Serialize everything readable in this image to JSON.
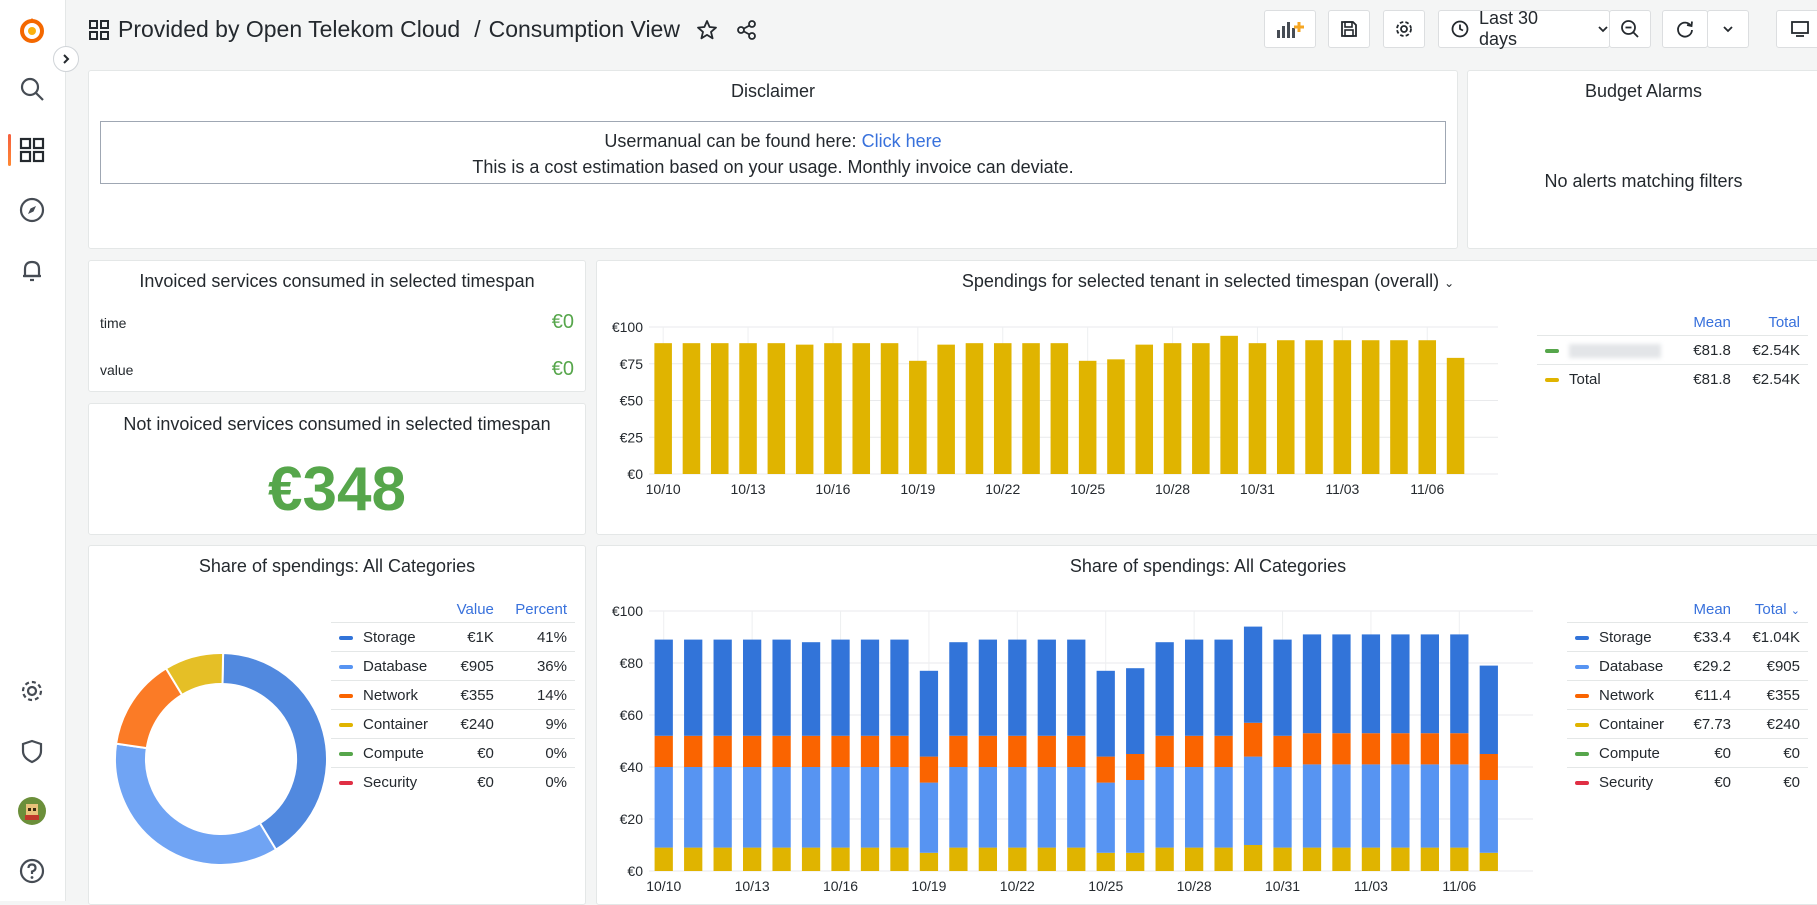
{
  "breadcrumb": {
    "folder": "Provided by Open Telekom Cloud",
    "separator": "/",
    "dashboard": "Consumption View"
  },
  "toolbar": {
    "time_range": "Last 30 days"
  },
  "disclaimer": {
    "title": "Disclaimer",
    "line1_prefix": "Usermanual can be found here:",
    "link_text": "Click here",
    "line2": "This is a cost estimation based on your usage. Monthly invoice can deviate."
  },
  "budget": {
    "title": "Budget Alarms",
    "empty_text": "No alerts matching filters"
  },
  "invoiced": {
    "title": "Invoiced services consumed in selected timespan",
    "rows": [
      {
        "label": "time",
        "value": "€0"
      },
      {
        "label": "value",
        "value": "€0"
      }
    ]
  },
  "not_invoiced": {
    "title": "Not invoiced services consumed in selected timespan",
    "value": "€348"
  },
  "spend_overall": {
    "title": "Spendings for selected tenant in selected timespan (overall)",
    "legend_headers": [
      "Mean",
      "Total"
    ],
    "legend": [
      {
        "name": "",
        "mean": "€81.8",
        "total": "€2.54K",
        "color": "#56a64b",
        "blurred": true
      },
      {
        "name": "Total",
        "mean": "€81.8",
        "total": "€2.54K",
        "color": "#e0b400"
      }
    ]
  },
  "share_donut": {
    "title": "Share of spendings: All Categories",
    "legend_headers": [
      "Value",
      "Percent"
    ],
    "legend": [
      {
        "name": "Storage",
        "value": "€1K",
        "percent": "41%",
        "color": "#3274d9"
      },
      {
        "name": "Database",
        "value": "€905",
        "percent": "36%",
        "color": "#5794f2"
      },
      {
        "name": "Network",
        "value": "€355",
        "percent": "14%",
        "color": "#fa6400"
      },
      {
        "name": "Container",
        "value": "€240",
        "percent": "9%",
        "color": "#e0b400"
      },
      {
        "name": "Compute",
        "value": "€0",
        "percent": "0%",
        "color": "#56a64b"
      },
      {
        "name": "Security",
        "value": "€0",
        "percent": "0%",
        "color": "#e02f44"
      }
    ]
  },
  "share_bars": {
    "title": "Share of spendings: All Categories",
    "legend_headers": [
      "Mean",
      "Total"
    ],
    "legend": [
      {
        "name": "Storage",
        "mean": "€33.4",
        "total": "€1.04K",
        "color": "#3274d9"
      },
      {
        "name": "Database",
        "mean": "€29.2",
        "total": "€905",
        "color": "#5794f2"
      },
      {
        "name": "Network",
        "mean": "€11.4",
        "total": "€355",
        "color": "#fa6400"
      },
      {
        "name": "Container",
        "mean": "€7.73",
        "total": "€240",
        "color": "#e0b400"
      },
      {
        "name": "Compute",
        "mean": "€0",
        "total": "€0",
        "color": "#56a64b"
      },
      {
        "name": "Security",
        "mean": "€0",
        "total": "€0",
        "color": "#e02f44"
      }
    ]
  },
  "chart_data": [
    {
      "type": "bar",
      "x_ticks": [
        "10/10",
        "10/13",
        "10/16",
        "10/19",
        "10/22",
        "10/25",
        "10/28",
        "10/31",
        "11/03",
        "11/06"
      ],
      "y_ticks": [
        "€0",
        "€25",
        "€50",
        "€75",
        "€100"
      ],
      "ylim": [
        0,
        100
      ],
      "series": [
        {
          "name": "Total",
          "values": [
            89,
            89,
            89,
            89,
            89,
            88,
            89,
            89,
            89,
            77,
            88,
            89,
            89,
            89,
            89,
            77,
            78,
            88,
            89,
            89,
            94,
            89,
            91,
            91,
            91,
            91,
            91,
            91,
            79,
            0
          ]
        }
      ]
    },
    {
      "type": "bar",
      "stacked": true,
      "x_ticks": [
        "10/10",
        "10/13",
        "10/16",
        "10/19",
        "10/22",
        "10/25",
        "10/28",
        "10/31",
        "11/03",
        "11/06"
      ],
      "y_ticks": [
        "€0",
        "€20",
        "€40",
        "€60",
        "€80",
        "€100"
      ],
      "ylim": [
        0,
        100
      ],
      "series": [
        {
          "name": "Container",
          "values": [
            9,
            9,
            9,
            9,
            9,
            9,
            9,
            9,
            9,
            7,
            9,
            9,
            9,
            9,
            9,
            7,
            7,
            9,
            9,
            9,
            10,
            9,
            9,
            9,
            9,
            9,
            9,
            9,
            7,
            0
          ]
        },
        {
          "name": "Database",
          "values": [
            31,
            31,
            31,
            31,
            31,
            31,
            31,
            31,
            31,
            27,
            31,
            31,
            31,
            31,
            31,
            27,
            28,
            31,
            31,
            31,
            34,
            31,
            32,
            32,
            32,
            32,
            32,
            32,
            28,
            0
          ]
        },
        {
          "name": "Network",
          "values": [
            12,
            12,
            12,
            12,
            12,
            12,
            12,
            12,
            12,
            10,
            12,
            12,
            12,
            12,
            12,
            10,
            10,
            12,
            12,
            12,
            13,
            12,
            12,
            12,
            12,
            12,
            12,
            12,
            10,
            0
          ]
        },
        {
          "name": "Storage",
          "values": [
            37,
            37,
            37,
            37,
            37,
            36,
            37,
            37,
            37,
            33,
            36,
            37,
            37,
            37,
            37,
            33,
            33,
            36,
            37,
            37,
            37,
            37,
            38,
            38,
            38,
            38,
            38,
            38,
            34,
            0
          ]
        }
      ]
    },
    {
      "type": "pie",
      "donut": true,
      "slices": [
        {
          "name": "Storage",
          "value": 41
        },
        {
          "name": "Database",
          "value": 36
        },
        {
          "name": "Network",
          "value": 14
        },
        {
          "name": "Container",
          "value": 9
        },
        {
          "name": "Compute",
          "value": 0
        },
        {
          "name": "Security",
          "value": 0
        }
      ]
    }
  ]
}
